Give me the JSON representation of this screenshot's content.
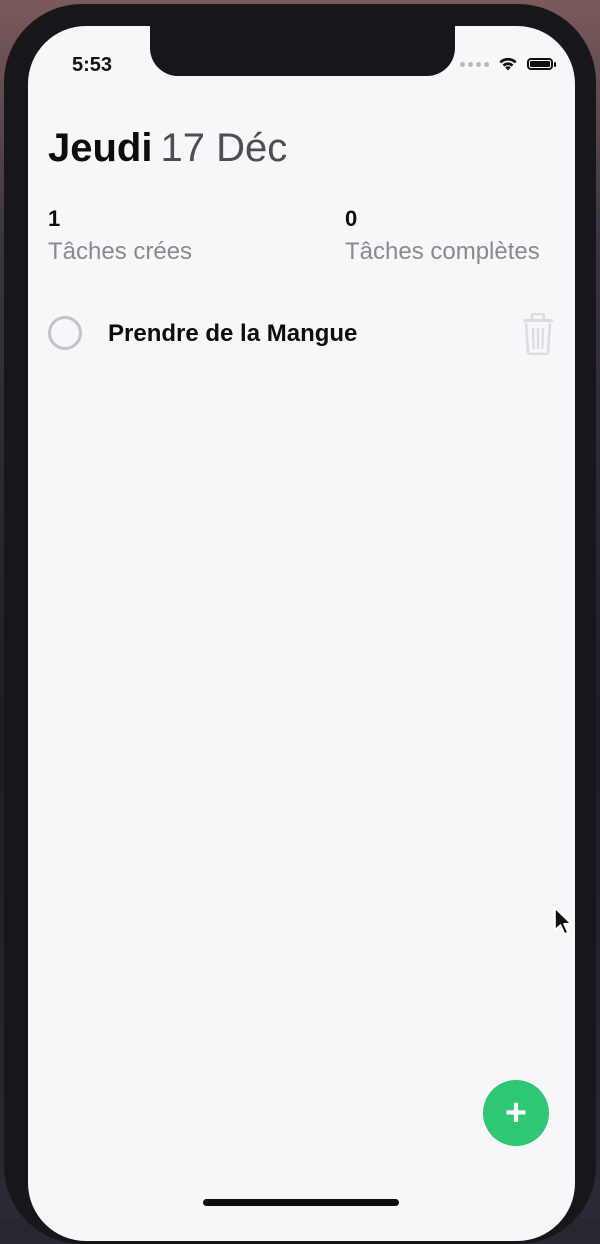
{
  "status_bar": {
    "time": "5:53",
    "icons": [
      "signal-dots-icon",
      "wifi-icon",
      "battery-icon"
    ]
  },
  "header": {
    "day": "Jeudi",
    "date": "17 Déc"
  },
  "stats": {
    "created": {
      "value": "1",
      "label": "Tâches crées"
    },
    "completed": {
      "value": "0",
      "label": "Tâches complètes"
    }
  },
  "tasks": [
    {
      "title": "Prendre de la Mangue",
      "completed": false
    }
  ],
  "fab": {
    "icon": "plus-icon",
    "label": "+"
  },
  "colors": {
    "accent": "#2ec773",
    "background": "#f7f6f9",
    "text": "#0d0d0d",
    "muted": "#8a8a8e"
  }
}
